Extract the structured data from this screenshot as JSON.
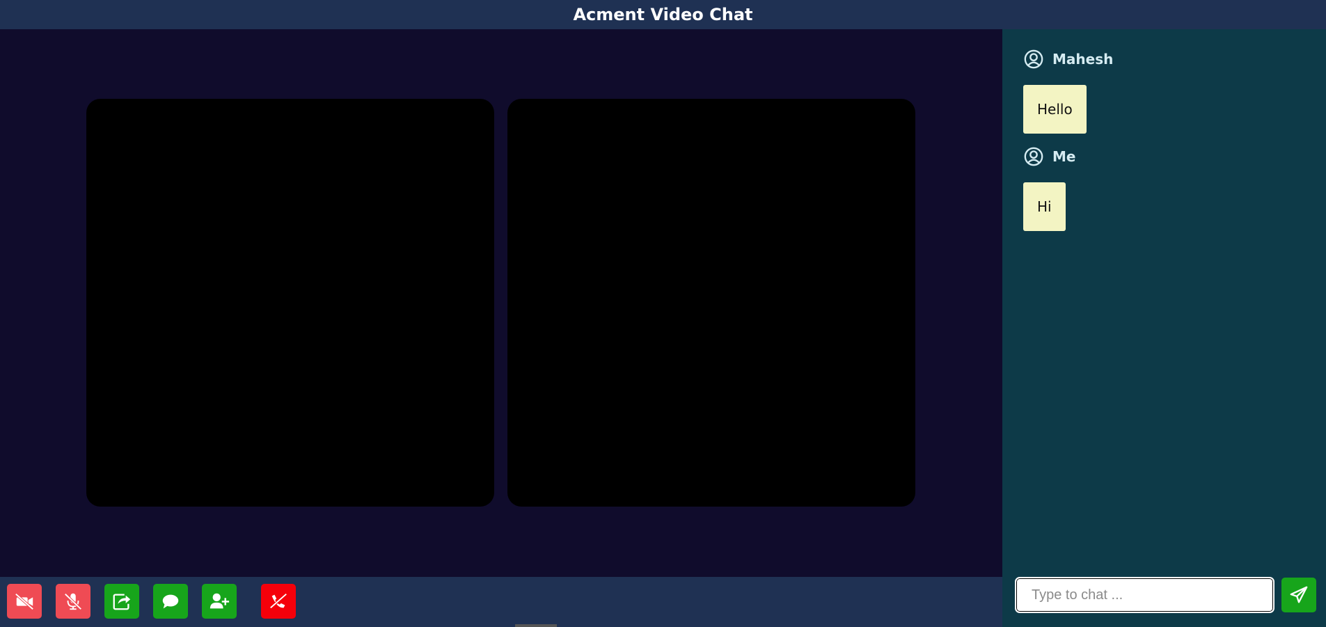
{
  "header": {
    "title": "Acment Video Chat"
  },
  "controls": [
    {
      "name": "camera-off-button",
      "icon": "video-slash-icon",
      "color": "#ef4b54"
    },
    {
      "name": "mic-off-button",
      "icon": "microphone-slash-icon",
      "color": "#ef4b54"
    },
    {
      "name": "share-screen-button",
      "icon": "share-square-icon",
      "color": "#17a51b"
    },
    {
      "name": "chat-toggle-button",
      "icon": "comment-icon",
      "color": "#17a51b"
    },
    {
      "name": "add-user-button",
      "icon": "user-plus-icon",
      "color": "#17a51b"
    },
    {
      "name": "end-call-button",
      "icon": "phone-slash-icon",
      "color": "#f5000a"
    }
  ],
  "chat": {
    "messages": [
      {
        "sender": "Mahesh",
        "text": "Hello"
      },
      {
        "sender": "Me",
        "text": "Hi"
      }
    ],
    "input": {
      "placeholder": "Type to chat ...",
      "value": ""
    },
    "send_icon": "paper-plane-icon"
  },
  "colors": {
    "header_bg": "#1f3153",
    "video_bg": "#100c2c",
    "chat_bg": "#0d3a48",
    "bubble_bg": "#f3f4c3",
    "accent_green": "#17a51b",
    "accent_red": "#f5000a"
  }
}
